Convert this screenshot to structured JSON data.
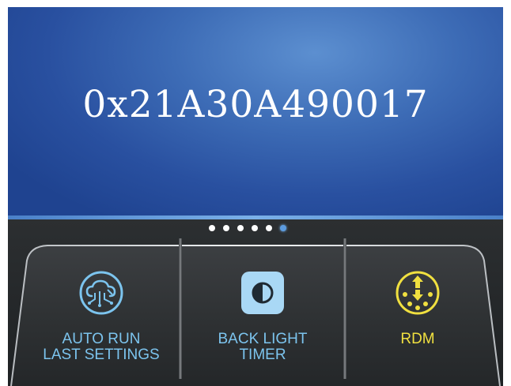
{
  "display": {
    "value": "0x21A30A490017"
  },
  "pager": {
    "count": 6,
    "active_index": 5
  },
  "tiles": [
    {
      "id": "auto-run",
      "label_line1": "AUTO RUN",
      "label_line2": "LAST SETTINGS",
      "icon": "cloud-circuit-icon",
      "color": "#7cc4ee"
    },
    {
      "id": "backlight",
      "label_line1": "BACK LIGHT",
      "label_line2": "TIMER",
      "icon": "half-circle-contrast-icon",
      "color": "#7cc4ee"
    },
    {
      "id": "rdm",
      "label_line1": "RDM",
      "label_line2": "",
      "icon": "dmx-connector-updown-icon",
      "color": "#f0e040"
    }
  ],
  "colors": {
    "display_blue": "#3d6cb6",
    "accent_cyan": "#7cc4ee",
    "accent_yellow": "#f0e040",
    "panel_dark": "#26292b"
  }
}
